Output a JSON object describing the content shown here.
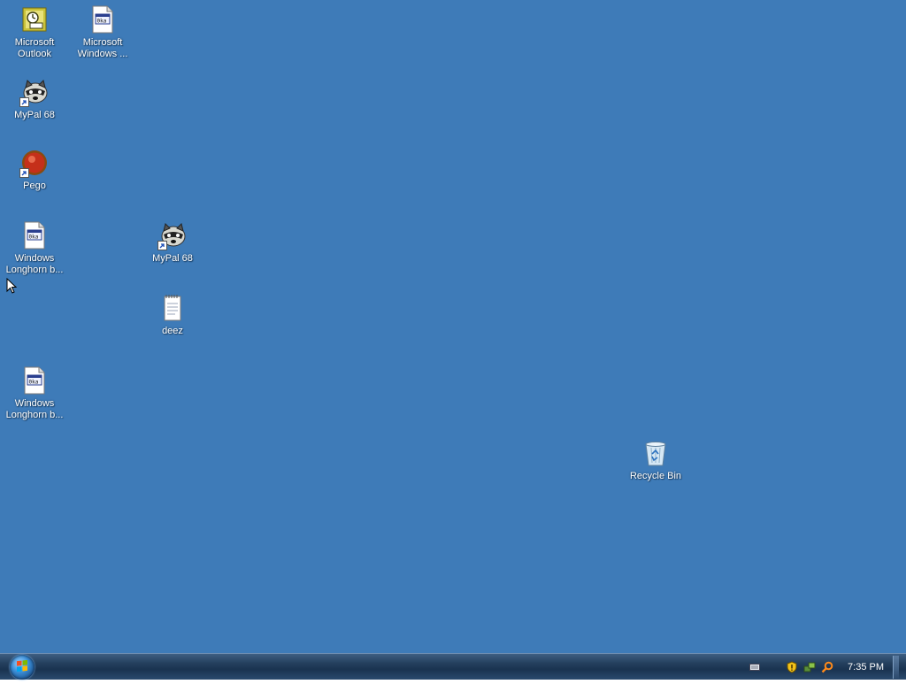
{
  "desktop": {
    "background_color": "#3e7bb8",
    "icons": [
      {
        "label": "Microsoft\nOutlook",
        "icon": "outlook-icon"
      },
      {
        "label": "Microsoft\nWindows ...",
        "icon": "document-icon"
      },
      {
        "label": "MyPal 68",
        "icon": "mypal-raccoon-icon",
        "shortcut": true
      },
      {
        "label": "Pego",
        "icon": "pego-icon",
        "shortcut": true
      },
      {
        "label": "Windows\nLonghorn b...",
        "icon": "document-icon"
      },
      {
        "label": "MyPal 68",
        "icon": "mypal-raccoon-icon",
        "shortcut": true
      },
      {
        "label": "deez",
        "icon": "notepad-icon"
      },
      {
        "label": "Windows\nLonghorn b...",
        "icon": "document-icon"
      },
      {
        "label": "Recycle Bin",
        "icon": "recycle-bin-icon"
      }
    ]
  },
  "taskbar": {
    "start_button": "start-orb-icon",
    "tray_icons": [
      "keyboard-icon",
      "security-shield-icon",
      "network-icon",
      "search-icon"
    ],
    "clock": "7:35 PM"
  }
}
